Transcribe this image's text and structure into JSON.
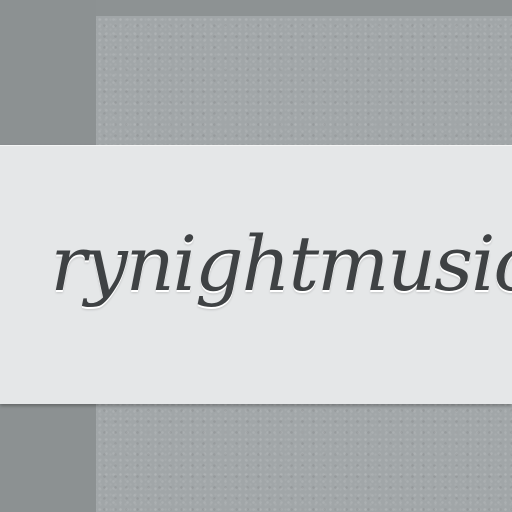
{
  "header": {
    "site_title": "rynightmusic"
  },
  "colors": {
    "frame": "#8c9192",
    "content_background": "#a1a6a8",
    "title_band": "#e5e7e8",
    "title_text": "#3f4244"
  }
}
